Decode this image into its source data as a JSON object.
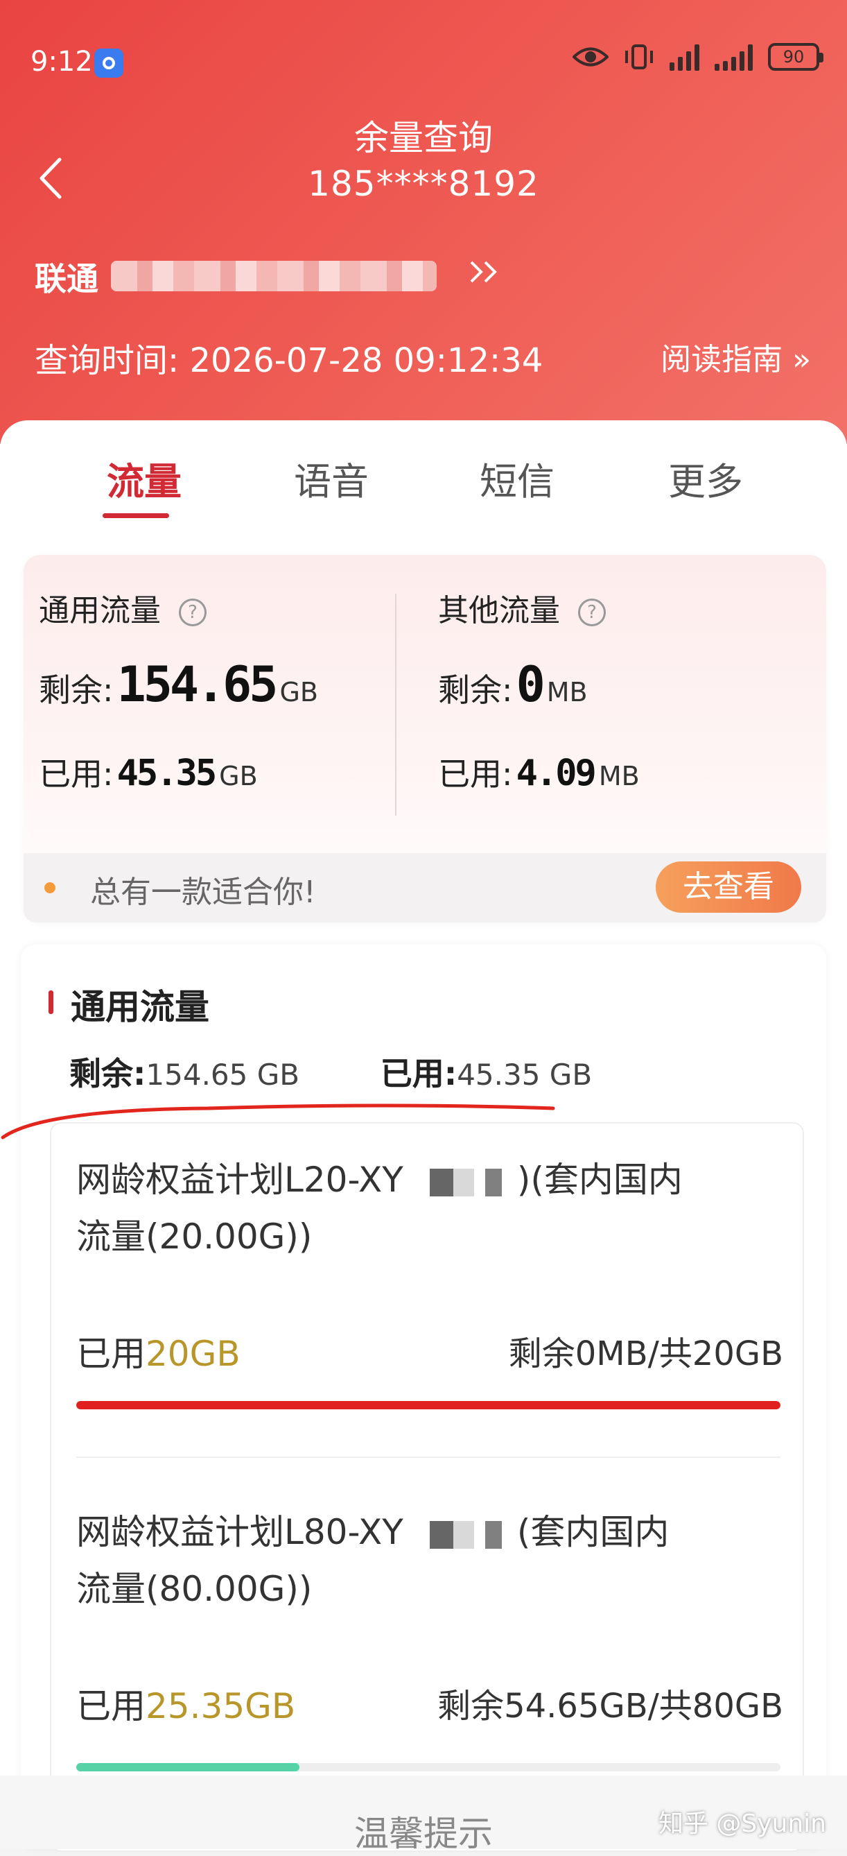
{
  "status": {
    "time": "9:12",
    "battery": "90"
  },
  "header": {
    "title": "余量查询",
    "phone": "185****8192",
    "carrier": "联通",
    "query_time_label": "查询时间:",
    "query_time": "2026-07-28 09:12:34",
    "guide": "阅读指南 »"
  },
  "tabs": [
    {
      "label": "流量",
      "active": true
    },
    {
      "label": "语音"
    },
    {
      "label": "短信"
    },
    {
      "label": "更多"
    }
  ],
  "summary": {
    "general": {
      "title": "通用流量",
      "remain_label": "剩余:",
      "remain": "154.65",
      "remain_unit": "GB",
      "used_label": "已用:",
      "used": "45.35",
      "used_unit": "GB"
    },
    "other": {
      "title": "其他流量",
      "remain_label": "剩余:",
      "remain": "0",
      "remain_unit": "MB",
      "used_label": "已用:",
      "used": "4.09",
      "used_unit": "MB"
    }
  },
  "promo": {
    "text": "总有一款适合你!",
    "button": "去查看"
  },
  "detail": {
    "title": "通用流量",
    "remain_label": "剩余:",
    "remain": "154.65 GB",
    "used_label": "已用:",
    "used": "45.35 GB",
    "packages": [
      {
        "name1": "网龄权益计划L20-XY",
        "name1b": ")(套内国内",
        "name2": "流量(20.00G))",
        "used_label": "已用",
        "used": "20GB",
        "remain": "剩余0MB/共20GB",
        "progress": 1.0,
        "bar_color": "#e0201f"
      },
      {
        "name1": "网龄权益计划L80-XY",
        "name1b": "(套内国内",
        "name2": "流量(80.00G))",
        "used_label": "已用",
        "used": "25.35GB",
        "remain": "剩余54.65GB/共80GB",
        "progress": 0.317,
        "bar_color": "#55d3a6"
      }
    ]
  },
  "footer": {
    "warm_tip": "温馨提示",
    "watermark": "知乎 @Syunin"
  },
  "colors": {
    "accent": "#d22a34",
    "header_bg": "#ec4e4a",
    "gold": "#b8962a"
  }
}
